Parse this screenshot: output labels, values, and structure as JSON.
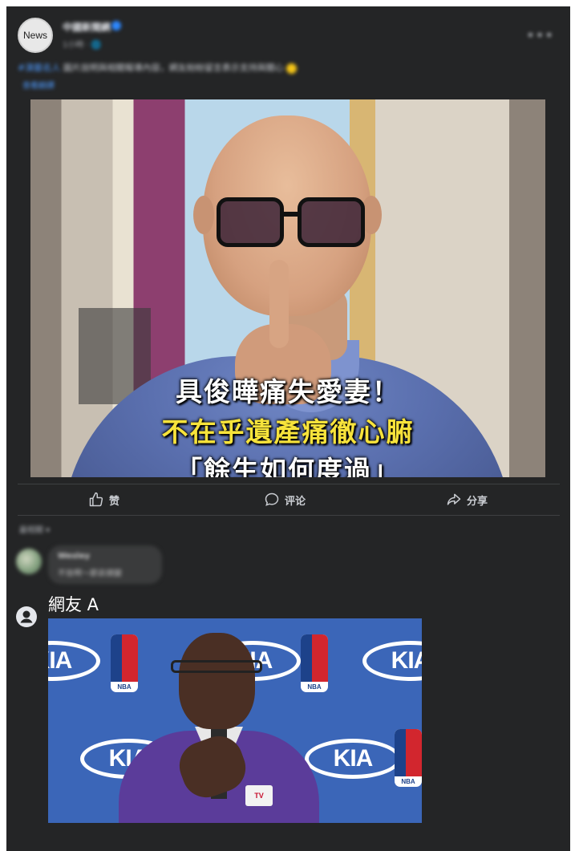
{
  "post": {
    "avatar_text": "News",
    "page_name": "中國新聞網",
    "meta": "1小時 · 🌐",
    "text_hashtag": "#演藝名人",
    "text_body": " 圖片說明與相關報導內容，網友紛紛留言表示支持與關心",
    "see_translation": "查看翻譯",
    "image_captions": [
      "具俊曄痛失愛妻！",
      "不在乎遺產痛徹心腑",
      "「餘生如何度過」"
    ]
  },
  "actions": {
    "like_label": "赞",
    "comment_label": "评论",
    "share_label": "分享"
  },
  "comments": {
    "sort_label": "最相關 ▾",
    "blurred_comment": {
      "name": "Wesley",
      "text": "不捨啊～節哀順變"
    },
    "reply": {
      "name": "網友 A",
      "image_logo_text": "KIA",
      "nba_text": "NBA",
      "mic_text": "TV"
    }
  },
  "colors": {
    "background": "#242526",
    "accent": "#2d88ff",
    "caption_yellow": "#f7e33b"
  }
}
